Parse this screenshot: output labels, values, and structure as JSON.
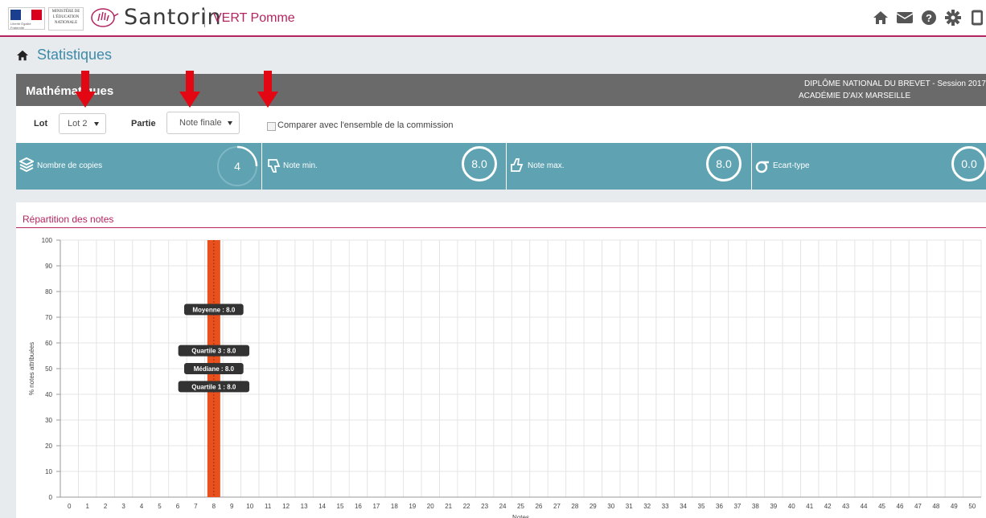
{
  "header": {
    "ministry_text": "MINISTÈRE DE L'ÉDUCATION NATIONALE",
    "brand": "Santorin",
    "subbrand": "VERT Pomme",
    "icons": [
      "home-icon",
      "envelope-icon",
      "help-icon",
      "gear-icon",
      "logout-icon"
    ]
  },
  "page": {
    "title": "Statistiques"
  },
  "exam_bar": {
    "subject": "Mathématiques",
    "exam_line1": "DIPLÔME NATIONAL DU BREVET - Session 2017",
    "exam_line2": "ACADÉMIE D'AIX MARSEILLE"
  },
  "filters": {
    "lot_label": "Lot",
    "lot_value": "Lot 2",
    "partie_label": "Partie",
    "partie_value": "Note finale",
    "compare_label": "Comparer avec l'ensemble de la commission"
  },
  "stats": [
    {
      "label": "Nombre de copies",
      "value": "4",
      "icon": "layers-icon"
    },
    {
      "label": "Note min.",
      "value": "8.0",
      "icon": "thumbs-down-icon"
    },
    {
      "label": "Note max.",
      "value": "8.0",
      "icon": "thumbs-up-icon"
    },
    {
      "label": "Ecart-type",
      "value": "0.0",
      "icon": "sigma-icon"
    }
  ],
  "chart_data": {
    "type": "bar",
    "title": "Répartition des notes",
    "ylabel": "% notes attribuées",
    "xlabel": "Notes",
    "ylim": [
      0,
      100
    ],
    "yticks": [
      0,
      10,
      20,
      30,
      40,
      50,
      60,
      70,
      80,
      90,
      100
    ],
    "x": [
      0,
      1,
      2,
      3,
      4,
      5,
      6,
      7,
      8,
      9,
      10,
      11,
      12,
      13,
      14,
      15,
      16,
      17,
      18,
      19,
      20,
      21,
      22,
      23,
      24,
      25,
      26,
      27,
      28,
      29,
      30,
      31,
      32,
      33,
      34,
      35,
      36,
      37,
      38,
      39,
      40,
      41,
      42,
      43,
      44,
      45,
      46,
      47,
      48,
      49,
      50
    ],
    "bars": [
      {
        "x": 8,
        "value": 100
      }
    ],
    "bar_color": "#e8501e",
    "grid": true,
    "annotations": [
      {
        "text": "Moyenne : 8.0",
        "y": 73
      },
      {
        "text": "Quartile 3 : 8.0",
        "y": 57
      },
      {
        "text": "Médiane : 8.0",
        "y": 50
      },
      {
        "text": "Quartile 1 : 8.0",
        "y": 43
      }
    ]
  }
}
